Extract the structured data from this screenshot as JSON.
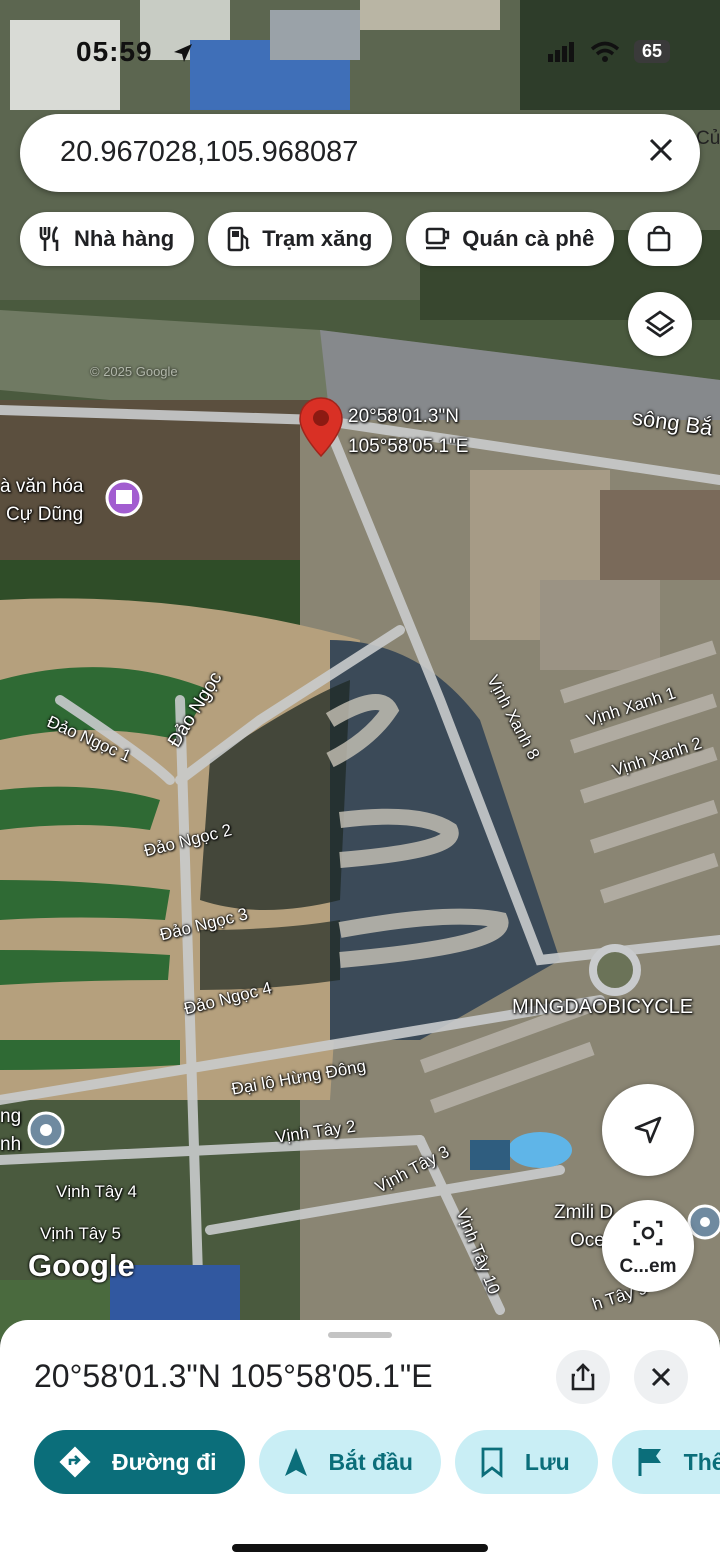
{
  "status_bar": {
    "time": "05:59",
    "battery": "65"
  },
  "search": {
    "query": "20.967028,105.968087",
    "close_icon": "close-icon"
  },
  "chips": [
    {
      "label": "Nhà hàng",
      "icon": "restaurant-icon"
    },
    {
      "label": "Trạm xăng",
      "icon": "gas-station-icon"
    },
    {
      "label": "Quán cà phê",
      "icon": "coffee-icon"
    },
    {
      "label": "",
      "icon": "shopping-bag-icon"
    }
  ],
  "map": {
    "pin_label_lat": "20°58'01.3\"N",
    "pin_label_lng": "105°58'05.1\"E",
    "place_labels": {
      "river": "sông Bắ",
      "cultural_house_line1": "à văn hóa",
      "cultural_house_line2": "Cự Dũng",
      "dao_ngoc": "Đảo Ngọc",
      "dao_ngoc_1": "Đảo Ngọc 1",
      "dao_ngoc_2": "Đảo Ngọc 2",
      "dao_ngoc_3": "Đảo Ngọc 3",
      "dao_ngoc_4": "Đảo Ngọc 4",
      "vinh_xanh_8": "Vịnh Xanh 8",
      "vinh_xanh_1": "Vịnh Xanh 1",
      "vinh_xanh_2": "Vịnh Xanh 2",
      "mingdao": "MINGDAOBICYCLE",
      "dai_lo": "Đại lộ Hừng Đông",
      "vinh_tay_2": "Vịnh Tây 2",
      "vinh_tay_3": "Vịnh Tây 3",
      "vinh_tay_4": "Vịnh Tây 4",
      "vinh_tay_5": "Vịnh Tây 5",
      "vinh_tay_9": "h Tây 9",
      "vinh_tay_10": "Vịnh Tây 10",
      "zmili_line1": "Zmili D",
      "zmili_line2": "Ocean",
      "left_edge_1": "ng",
      "left_edge_2": "nh",
      "top_right": "Củ",
      "copyright": "© 2025 Google"
    },
    "google_logo": "Google",
    "lens_label": "C...em"
  },
  "sheet": {
    "title": "20°58'01.3\"N 105°58'05.1\"E",
    "actions": [
      {
        "label": "Đường đi",
        "icon": "directions-icon",
        "style": "primary"
      },
      {
        "label": "Bắt đầu",
        "icon": "navigation-arrow-icon",
        "style": "secondary"
      },
      {
        "label": "Lưu",
        "icon": "bookmark-icon",
        "style": "secondary"
      },
      {
        "label": "Thê",
        "icon": "flag-icon",
        "style": "secondary"
      }
    ]
  },
  "colors": {
    "primary": "#0b6e7a",
    "secondary_bg": "#c9eef5",
    "pin": "#d93025"
  }
}
